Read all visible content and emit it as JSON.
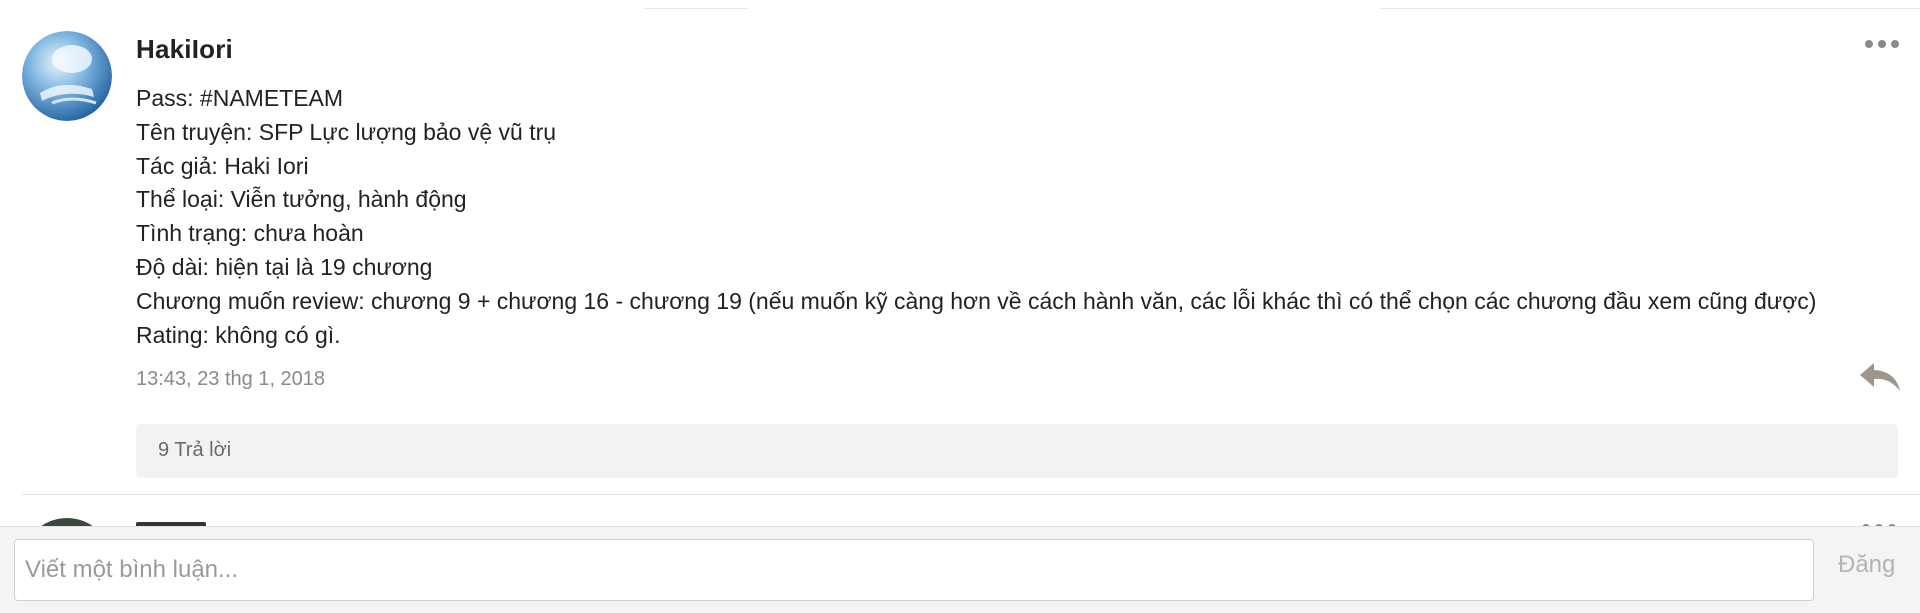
{
  "comment": {
    "username": "HakiIori",
    "body_lines": [
      "Pass: #NAMETEAM",
      "Tên truyện: SFP Lực lượng bảo vệ vũ trụ",
      "Tác giả: Haki Iori",
      "Thể loại: Viễn tưởng, hành động",
      "Tình trạng: chưa hoàn",
      "Độ dài: hiện tại là 19 chương",
      "Chương muốn review: chương 9 + chương 16 - chương 19 (nếu muốn kỹ càng hơn về cách hành văn, các lỗi khác thì có thể chọn các chương đầu xem cũng được)",
      "Rating: không có gì."
    ],
    "timestamp": "13:43, 23 thg 1, 2018",
    "replies_label": "9 Trả lời",
    "icons": {
      "more": "more-horizontal-icon",
      "reply": "reply-arrow-icon"
    }
  },
  "compose": {
    "placeholder": "Viết một bình luận...",
    "value": "",
    "post_label": "Đăng"
  },
  "colors": {
    "text": "#222222",
    "muted": "#8a8a8a",
    "replies_bg": "#f2f2f2",
    "post_disabled": "#b4b4b4"
  }
}
